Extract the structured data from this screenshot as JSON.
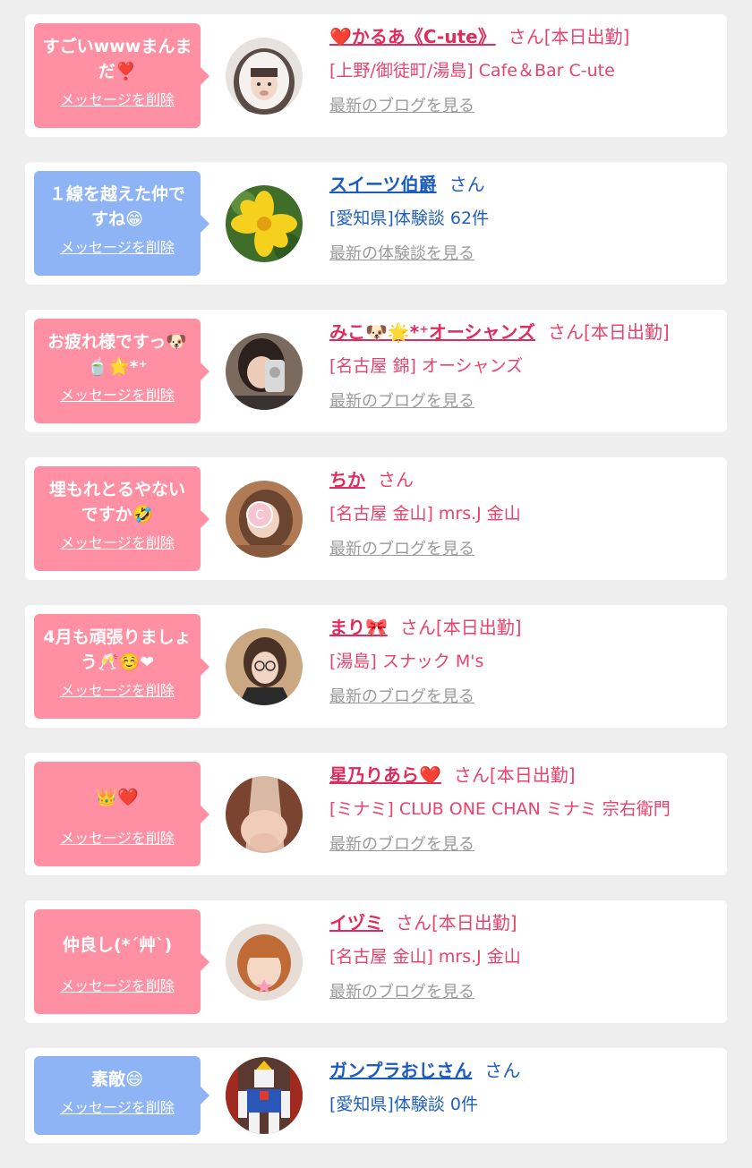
{
  "delete_label": "メッセージを削除",
  "colors": {
    "pink_bubble": "#ff8fa3",
    "blue_bubble": "#8fb4f5",
    "pink_text": "#e8436c",
    "blue_text": "#1f5fbf",
    "link_gray": "#9a9a9a"
  },
  "items": [
    {
      "message": "すごいwwwまんまだ❣️",
      "name": "❤️かるあ《C-ute》",
      "suffix": "さん[本日出勤]",
      "subtitle": "[上野/御徒町/湯島] Cafe＆Bar C-ute",
      "link": "最新のブログを見る",
      "avatar_icon": "girl-hood-avatar"
    },
    {
      "message": "１線を越えた仲ですね😁",
      "name": "スイーツ伯爵",
      "suffix": "さん",
      "subtitle": "[愛知県]体験談 62件",
      "link": "最新の体験談を見る",
      "avatar_icon": "yellow-flower-avatar"
    },
    {
      "message": "お疲れ様ですっ🐶🍵🌟*⁺",
      "name": "みこ🐶🌟*⁺オーシャンズ",
      "suffix": "さん[本日出勤]",
      "subtitle": "[名古屋 錦] オーシャンズ",
      "link": "最新のブログを見る",
      "avatar_icon": "girl-phone-avatar"
    },
    {
      "message": "埋もれとるやないですか🤣",
      "name": "ちか",
      "suffix": "さん",
      "subtitle": "[名古屋 金山] mrs.J 金山",
      "link": "最新のブログを見る",
      "avatar_icon": "girl-sticker-avatar"
    },
    {
      "message": "4月も頑張りましょう🥂☺️❤",
      "name": "まり🎀",
      "suffix": "さん[本日出勤]",
      "subtitle": "[湯島] スナック M's",
      "link": "最新のブログを見る",
      "avatar_icon": "girl-glasses-avatar"
    },
    {
      "message": "👑❤️",
      "name": "星乃りあら❤️",
      "suffix": "さん[本日出勤]",
      "subtitle": "[ミナミ] CLUB ONE CHAN ミナミ 宗右衛門",
      "link": "最新のブログを見る",
      "avatar_icon": "girl-hair-avatar"
    },
    {
      "message": "仲良し(*´艸`)",
      "name": "イヅミ",
      "suffix": "さん[本日出勤]",
      "subtitle": "[名古屋 金山] mrs.J 金山",
      "link": "最新のブログを見る",
      "avatar_icon": "girl-bob-avatar"
    },
    {
      "message": "素敵😄",
      "name": "ガンプラおじさん",
      "suffix": "さん",
      "subtitle": "[愛知県]体験談 0件",
      "link": "",
      "avatar_icon": "robot-model-avatar"
    }
  ]
}
